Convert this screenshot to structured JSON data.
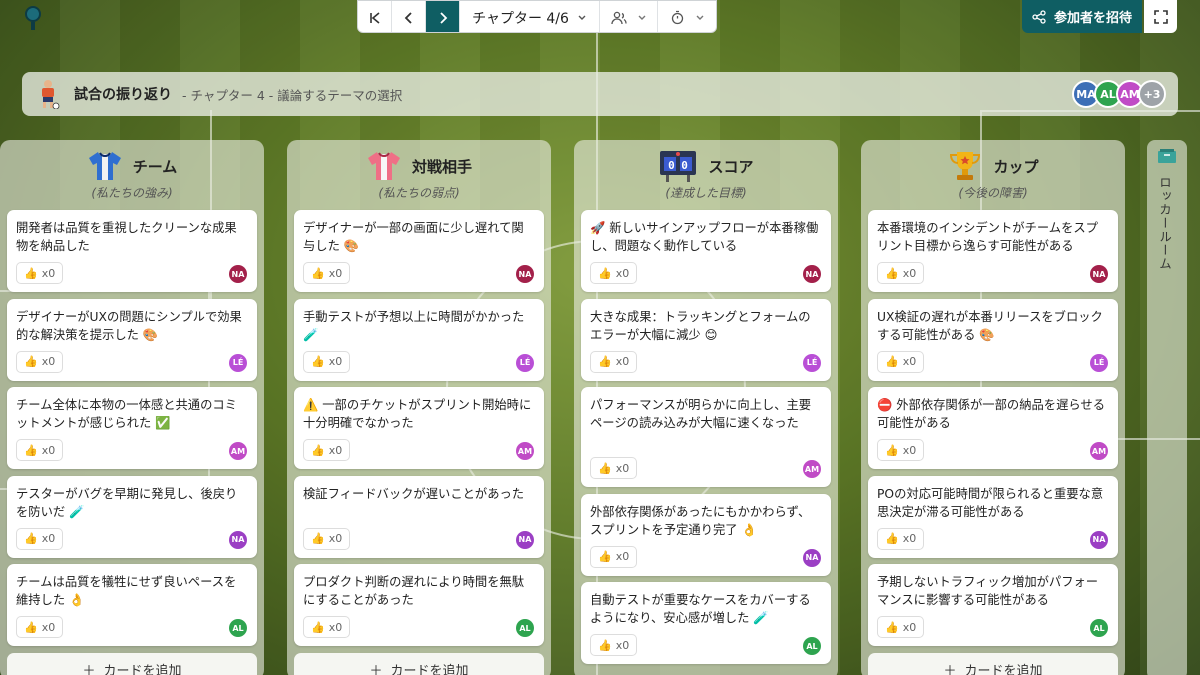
{
  "toolbar": {
    "chapter_label": "チャプター 4/6"
  },
  "invite_label": "参加者を招待",
  "header": {
    "title": "試合の振り返り",
    "subtitle": "- チャプター 4 - 議論するテーマの選択",
    "avatars": [
      "MA",
      "AL",
      "AM",
      "+3"
    ]
  },
  "colors": {
    "accent": "#0f5e63",
    "NA": "#a3204a",
    "LE": "#b94fd6",
    "AM": "#c04bc6",
    "AL": "#2ea44f",
    "MA": "#3d6fb6"
  },
  "columns": [
    {
      "title": "チーム",
      "subtitle": "(私たちの強み)",
      "icon": "jersey-blue-icon",
      "cards": [
        {
          "text": "開発者は品質を重視したクリーンな成果物を納品した",
          "likes": "x0",
          "author": "NA"
        },
        {
          "text": "デザイナーがUXの問題にシンプルで効果的な解決策を提示した 🎨",
          "likes": "x0",
          "author": "LÉ"
        },
        {
          "text": "チーム全体に本物の一体感と共通のコミットメントが感じられた ✅",
          "likes": "x0",
          "author": "AM"
        },
        {
          "text": "テスターがバグを早期に発見し、後戻りを防いだ 🧪",
          "likes": "x0",
          "author": "NA"
        },
        {
          "text": "チームは品質を犠牲にせず良いペースを維持した 👌",
          "likes": "x0",
          "author": "AL"
        }
      ],
      "add_label": "カードを追加"
    },
    {
      "title": "対戦相手",
      "subtitle": "(私たちの弱点)",
      "icon": "jersey-pink-icon",
      "cards": [
        {
          "text": "デザイナーが一部の画面に少し遅れて関与した 🎨",
          "likes": "x0",
          "author": "NA"
        },
        {
          "text": "手動テストが予想以上に時間がかかった 🧪",
          "likes": "x0",
          "author": "LÉ"
        },
        {
          "text": "⚠️ 一部のチケットがスプリント開始時に十分明確でなかった",
          "likes": "x0",
          "author": "AM"
        },
        {
          "text": "検証フィードバックが遅いことがあった",
          "likes": "x0",
          "author": "NA"
        },
        {
          "text": "プロダクト判断の遅れにより時間を無駄にすることがあった",
          "likes": "x0",
          "author": "AL"
        }
      ],
      "add_label": "カードを追加"
    },
    {
      "title": "スコア",
      "subtitle": "(達成した目標)",
      "icon": "scoreboard-icon",
      "score": "0 0",
      "cards": [
        {
          "text": "🚀 新しいサインアップフローが本番稼働し、問題なく動作している",
          "likes": "x0",
          "author": "NA"
        },
        {
          "text": "大きな成果：トラッキングとフォームのエラーが大幅に減少 😊",
          "likes": "x0",
          "author": "LÉ"
        },
        {
          "text": "パフォーマンスが明らかに向上し、主要ページの読み込みが大幅に速くなった",
          "likes": "x0",
          "author": "AM"
        },
        {
          "text": "外部依存関係があったにもかかわらず、スプリントを予定通り完了 👌",
          "likes": "x0",
          "author": "NA"
        },
        {
          "text": "自動テストが重要なケースをカバーするようになり、安心感が増した 🧪",
          "likes": "x0",
          "author": "AL"
        }
      ],
      "add_label": ""
    },
    {
      "title": "カップ",
      "subtitle": "(今後の障害)",
      "icon": "trophy-icon",
      "cards": [
        {
          "text": "本番環境のインシデントがチームをスプリント目標から逸らす可能性がある",
          "likes": "x0",
          "author": "NA"
        },
        {
          "text": "UX検証の遅れが本番リリースをブロックする可能性がある 🎨",
          "likes": "x0",
          "author": "LÉ"
        },
        {
          "text": "⛔ 外部依存関係が一部の納品を遅らせる可能性がある",
          "likes": "x0",
          "author": "AM"
        },
        {
          "text": "POの対応可能時間が限られると重要な意思決定が滞る可能性がある",
          "likes": "x0",
          "author": "NA"
        },
        {
          "text": "予期しないトラフィック増加がパフォーマンスに影響する可能性がある",
          "likes": "x0",
          "author": "AL"
        }
      ],
      "add_label": "カードを追加"
    }
  ],
  "locker_label": "ロッカールーム"
}
